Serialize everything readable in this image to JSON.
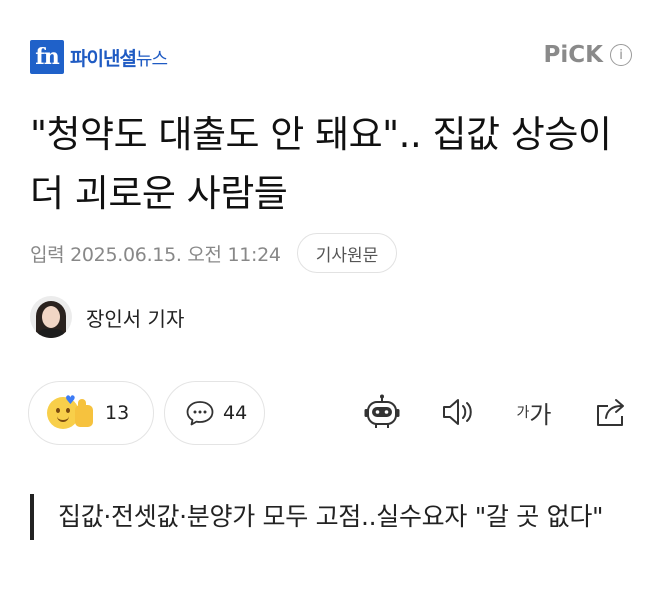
{
  "header": {
    "logo_mark": "fn",
    "logo_name": "파이낸셜",
    "logo_suffix": "뉴스",
    "pick_label": "PiCK",
    "info_glyph": "i"
  },
  "article": {
    "title": "\"청약도 대출도 안 돼요\".. 집값 상승이 더 괴로운 사람들",
    "date": "입력 2025.06.15. 오전 11:24",
    "original_button": "기사원문",
    "reporter": "장인서 기자",
    "subtitle": "집값·전셋값·분양가 모두 고점..실수요자 \"갈 곳 없다\""
  },
  "actions": {
    "reaction_count": "13",
    "comment_count": "44",
    "font_small": "가",
    "font_big": "가"
  },
  "icons": {
    "reaction": "reaction-emoji-icon",
    "comment": "comment-bubble-icon",
    "summary_bot": "robot-icon",
    "tts": "speaker-icon",
    "font_size": "font-size-icon",
    "share": "share-icon",
    "info": "info-icon"
  },
  "colors": {
    "brand_blue": "#1f61c9",
    "pick_gray": "#8a8a8a",
    "meta_gray": "#888888",
    "text": "#111111"
  }
}
